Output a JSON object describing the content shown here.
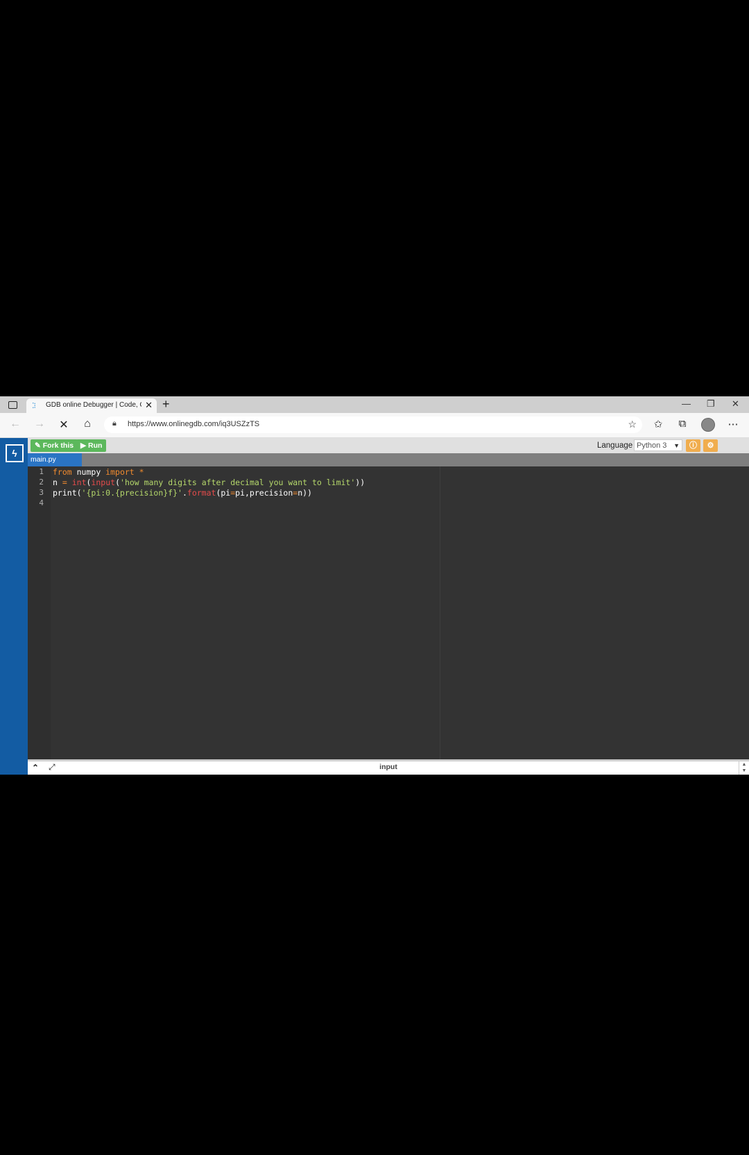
{
  "browser": {
    "tab": {
      "title": "GDB online Debugger | Code, Co",
      "favicon": "dots-favicon"
    },
    "url": "https://www.onlinegdb.com/iq3USZzTS"
  },
  "toolbar": {
    "fork_label": "Fork this",
    "run_label": "Run",
    "language_label": "Language",
    "language_value": "Python 3"
  },
  "file_tab": "main.py",
  "editor": {
    "line_numbers": [
      "1",
      "2",
      "3",
      "4"
    ],
    "lines": [
      [
        {
          "t": "from",
          "c": "kw"
        },
        {
          "t": " numpy ",
          "c": ""
        },
        {
          "t": "import",
          "c": "kw"
        },
        {
          "t": " ",
          "c": ""
        },
        {
          "t": "*",
          "c": "kw"
        }
      ],
      [
        {
          "t": "n ",
          "c": ""
        },
        {
          "t": "=",
          "c": "kw"
        },
        {
          "t": " ",
          "c": ""
        },
        {
          "t": "int",
          "c": "fn"
        },
        {
          "t": "(",
          "c": ""
        },
        {
          "t": "input",
          "c": "fn"
        },
        {
          "t": "(",
          "c": ""
        },
        {
          "t": "'how many digits after decimal you want to limit'",
          "c": "str"
        },
        {
          "t": "))",
          "c": ""
        }
      ],
      [
        {
          "t": "print(",
          "c": ""
        },
        {
          "t": "'{pi:0.{precision}f}'",
          "c": "str"
        },
        {
          "t": ".",
          "c": ""
        },
        {
          "t": "format",
          "c": "fn"
        },
        {
          "t": "(pi",
          "c": ""
        },
        {
          "t": "=",
          "c": "kw"
        },
        {
          "t": "pi,precision",
          "c": ""
        },
        {
          "t": "=",
          "c": "kw"
        },
        {
          "t": "n))",
          "c": ""
        }
      ],
      []
    ]
  },
  "bottom_panel": {
    "label": "input"
  },
  "colors": {
    "sidebar": "#135ca3",
    "run_button": "#5cb85c",
    "accent_orange": "#f0ad4e",
    "editor_bg": "#333333"
  }
}
